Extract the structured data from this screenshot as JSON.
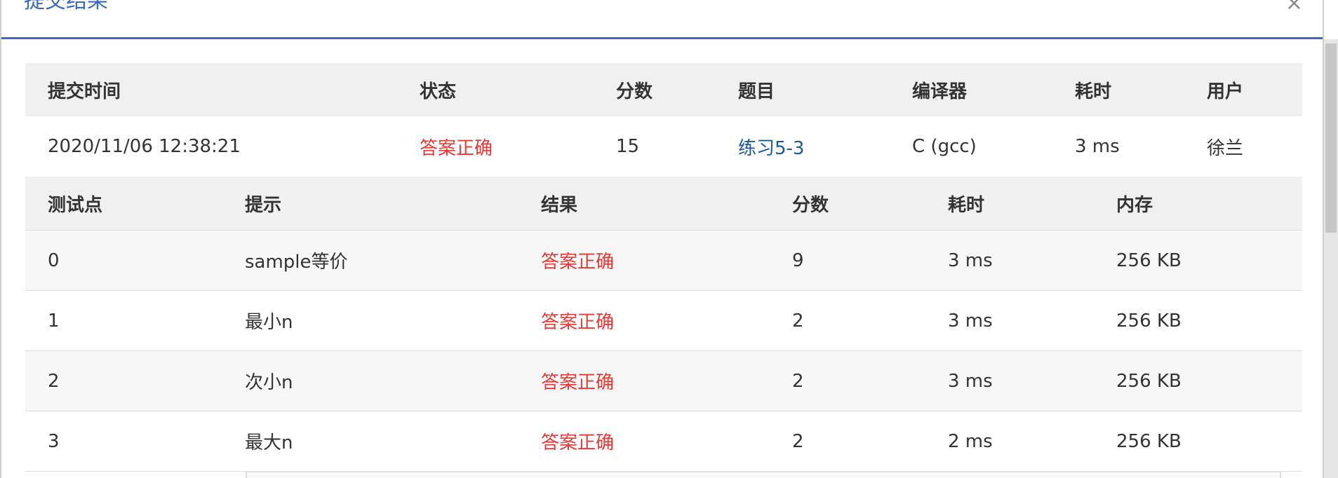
{
  "modal": {
    "title": "提交结果",
    "close_symbol": "×"
  },
  "summary": {
    "headers": [
      "提交时间",
      "状态",
      "分数",
      "题目",
      "编译器",
      "耗时",
      "用户"
    ],
    "row": {
      "submit_time": "2020/11/06 12:38:21",
      "status": "答案正确",
      "score": "15",
      "problem": "练习5-3",
      "compiler": "C (gcc)",
      "time": "3 ms",
      "user": "徐兰"
    }
  },
  "cases": {
    "headers": [
      "测试点",
      "提示",
      "结果",
      "分数",
      "耗时",
      "内存"
    ],
    "rows": [
      {
        "id": "0",
        "hint": "sample等价",
        "result": "答案正确",
        "score": "9",
        "time": "3 ms",
        "memory": "256 KB"
      },
      {
        "id": "1",
        "hint": "最小n",
        "result": "答案正确",
        "score": "2",
        "time": "3 ms",
        "memory": "256 KB"
      },
      {
        "id": "2",
        "hint": "次小n",
        "result": "答案正确",
        "score": "2",
        "time": "3 ms",
        "memory": "256 KB"
      },
      {
        "id": "3",
        "hint": "最大n",
        "result": "答案正确",
        "score": "2",
        "time": "2 ms",
        "memory": "256 KB"
      }
    ]
  },
  "colors": {
    "accent": "#3b6ab8",
    "status_ok": "#e53935",
    "link": "#1a5a96",
    "header_bg": "#f0f0f0"
  },
  "icons": {
    "close": "close-icon"
  }
}
